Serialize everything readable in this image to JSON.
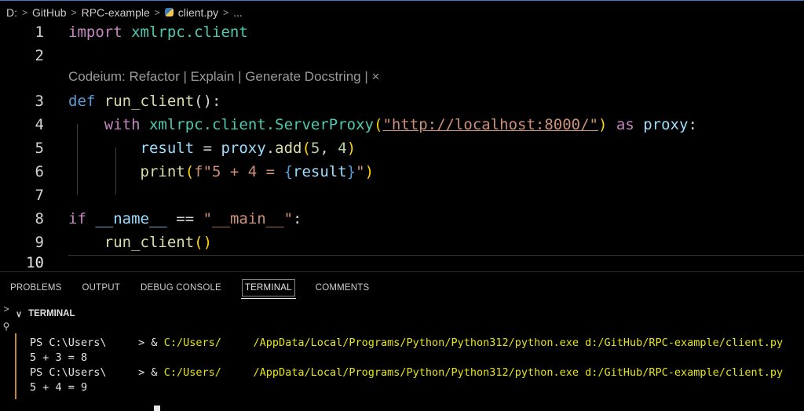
{
  "breadcrumb": {
    "items": [
      "D:",
      "GitHub",
      "RPC-example",
      "client.py",
      "..."
    ]
  },
  "editor": {
    "line_numbers": [
      "1",
      "2",
      "3",
      "4",
      "5",
      "6",
      "7",
      "8",
      "9",
      "10"
    ],
    "codelens": "Codeium: Refactor | Explain | Generate Docstring | ×",
    "lines": {
      "l1": {
        "kw": "import",
        "mod": "xmlrpc.client"
      },
      "l3": {
        "kw": "def",
        "fn": "run_client",
        "rest": "():"
      },
      "l4": {
        "kw": "with",
        "mod": "xmlrpc.client.",
        "cls": "ServerProxy",
        "url": "\"http://localhost:8000/\"",
        "as": "as",
        "var": "proxy",
        "end": ":"
      },
      "l5": {
        "var1": "result",
        "op": " = ",
        "var2": "proxy",
        "dot": ".",
        "fn": "add",
        "a": "5",
        "comma": ", ",
        "b": "4"
      },
      "l6": {
        "fn": "print",
        "pre": "f\"5 + 4 = ",
        "var": "result",
        "post": "\""
      },
      "l8": {
        "kw": "if",
        "var": "__name__",
        "op": " == ",
        "str": "\"__main__\"",
        "end": ":"
      },
      "l9": {
        "fn": "run_client"
      }
    }
  },
  "panel": {
    "tabs": [
      "PROBLEMS",
      "OUTPUT",
      "DEBUG CONSOLE",
      "TERMINAL",
      "COMMENTS"
    ],
    "active_tab": "TERMINAL",
    "section_title": "TERMINAL"
  },
  "terminal": {
    "lines": [
      {
        "prompt": "PS C:\\Users\\     > & ",
        "path": "C:/Users/",
        "cmd": "     /AppData/Local/Programs/Python/Python312/python.exe d:/GitHub/RPC-example/client.py"
      },
      {
        "text": "5 + 3 = 8"
      },
      {
        "prompt": "PS C:\\Users\\     > & ",
        "path": "C:/Users/",
        "cmd": "     /AppData/Local/Programs/Python/Python312/python.exe d:/GitHub/RPC-example/client.py"
      },
      {
        "text": "5 + 4 = 9"
      }
    ]
  },
  "colors": {
    "keyword": "#c586c0",
    "module": "#4ec9b0",
    "function": "#dcdcaa",
    "variable": "#9cdcfe",
    "string": "#ce9178",
    "number": "#b5cea8",
    "terminal_path": "#e5e510",
    "terminal_border": "#c08a2e"
  }
}
